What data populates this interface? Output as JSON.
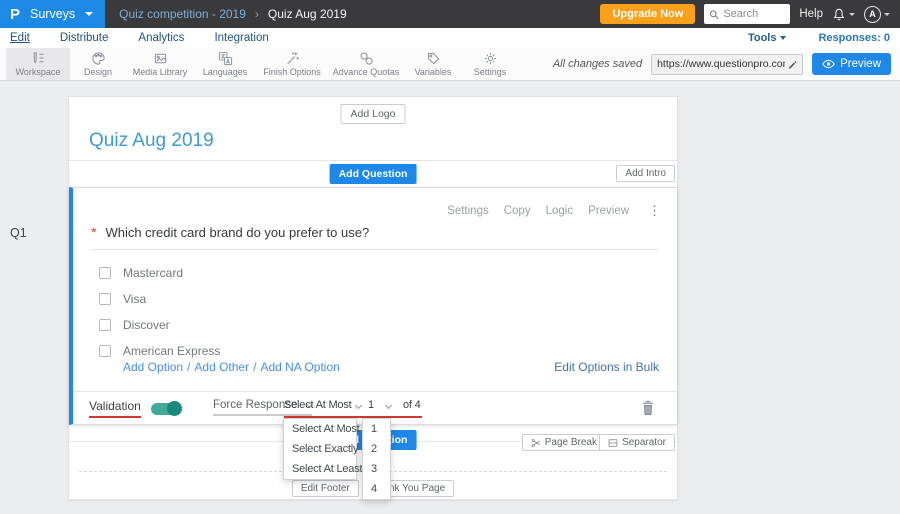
{
  "topbar": {
    "logo_text": "P",
    "product_label": "Surveys",
    "breadcrumb": {
      "parent": "Quiz competition - 2019",
      "separator": "›",
      "current": "Quiz Aug 2019"
    },
    "upgrade_label": "Upgrade Now",
    "search_placeholder": "Search",
    "help_label": "Help",
    "avatar_initial": "A"
  },
  "nav": {
    "items": [
      "Edit",
      "Distribute",
      "Analytics",
      "Integration"
    ],
    "active_item": "Edit",
    "tools_label": "Tools",
    "responses_label": "Responses: 0"
  },
  "toolbar": {
    "tools": [
      {
        "label": "Workspace",
        "icon": "workspace-icon",
        "active": true
      },
      {
        "label": "Design",
        "icon": "design-icon",
        "active": false
      },
      {
        "label": "Media Library",
        "icon": "media-library-icon",
        "active": false
      },
      {
        "label": "Languages",
        "icon": "languages-icon",
        "active": false
      },
      {
        "label": "Finish Options",
        "icon": "finish-options-icon",
        "active": false
      },
      {
        "label": "Advance Quotas",
        "icon": "advance-quotas-icon",
        "active": false
      },
      {
        "label": "Variables",
        "icon": "variables-icon",
        "active": false
      },
      {
        "label": "Settings",
        "icon": "settings-icon",
        "active": false
      }
    ],
    "saved_text": "All changes saved",
    "url_value": "https://www.questionpro.com/t/APNrFZ",
    "preview_label": "Preview"
  },
  "survey": {
    "add_logo_label": "Add Logo",
    "title": "Quiz Aug 2019",
    "add_question_label": "Add Question",
    "add_intro_label": "Add Intro",
    "question": {
      "id_label": "Q1",
      "actions": [
        "Settings",
        "Copy",
        "Logic",
        "Preview"
      ],
      "menu_glyph": "⋮",
      "required_marker": "*",
      "text": "Which credit card brand do you prefer to use?",
      "options": [
        "Mastercard",
        "Visa",
        "Discover",
        "American Express"
      ],
      "links": {
        "add_option": "Add Option",
        "add_other": "Add Other",
        "add_na": "Add NA Option",
        "separator": "/"
      },
      "edit_bulk_label": "Edit Options in Bulk",
      "validation": {
        "label": "Validation",
        "toggle_on": true,
        "force_response_label": "Force Response",
        "rule_value": "Select At Most",
        "count_value": "1",
        "of_label": "of 4"
      }
    },
    "footer": {
      "page_break_label": "Page Break",
      "separator_label": "Separator",
      "edit_footer_label": "Edit Footer",
      "thank_you_label": "Thank You Page"
    }
  },
  "dropdowns": {
    "rule_options": [
      "Select At Most",
      "Select Exactly",
      "Select At Least"
    ],
    "count_options": [
      "1",
      "2",
      "3",
      "4"
    ]
  },
  "colors": {
    "accent_blue": "#1e88e5",
    "topbar_dark": "#3a393b",
    "upgrade_orange": "#f9a11c",
    "toggle_teal": "#43a79b",
    "underline_red": "#cc3a30",
    "title_blue": "#3d9ad6",
    "link_blue": "#4a90e2"
  }
}
